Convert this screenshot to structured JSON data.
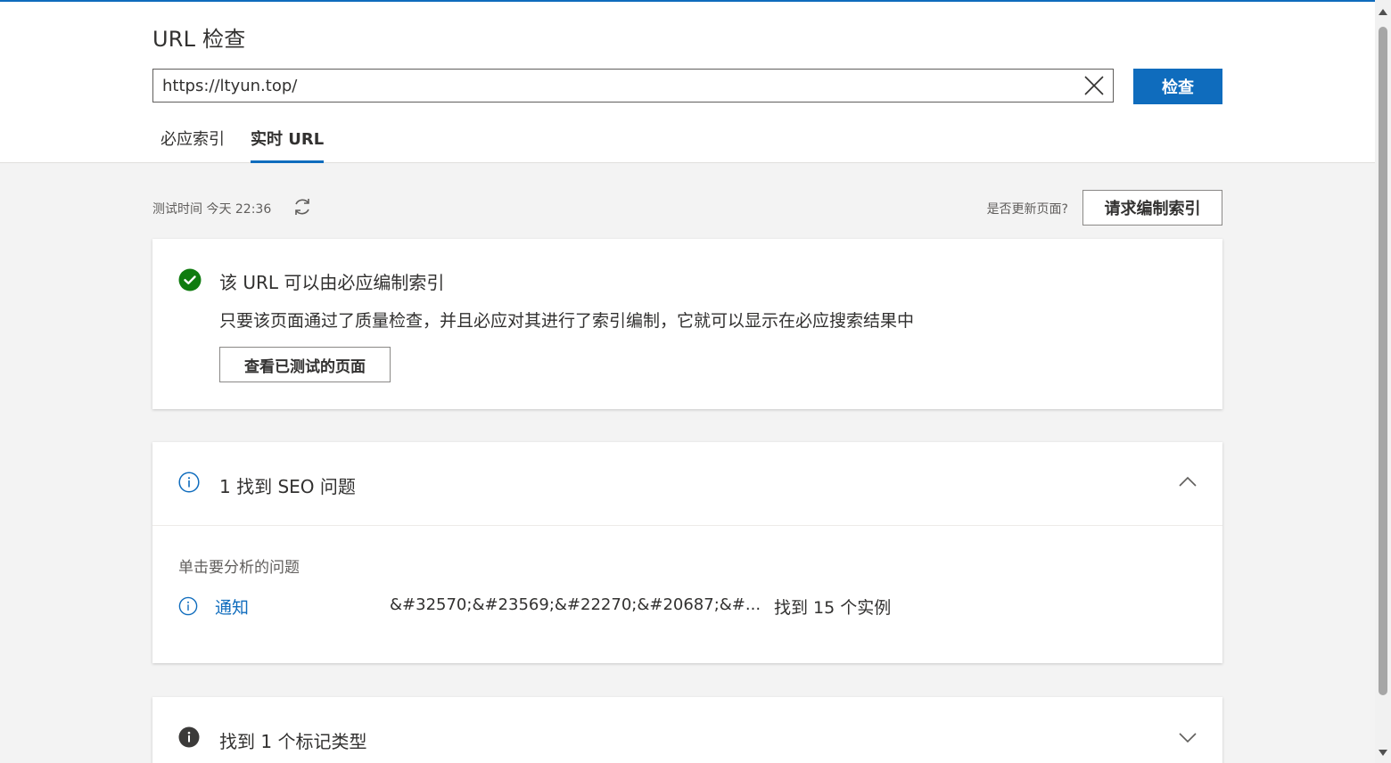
{
  "header": {
    "title": "URL 检查",
    "url_value": "https://ltyun.top/",
    "check_label": "检查",
    "tabs": [
      {
        "label": "必应索引",
        "active": false
      },
      {
        "label": "实时 URL",
        "active": true
      }
    ]
  },
  "meta": {
    "test_time": "测试时间 今天 22:36",
    "update_question": "是否更新页面?",
    "request_index_label": "请求编制索引"
  },
  "index_status": {
    "title": "该 URL 可以由必应编制索引",
    "description": "只要该页面通过了质量检查，并且必应对其进行了索引编制，它就可以显示在必应搜索结果中",
    "view_tested_label": "查看已测试的页面",
    "icon": "check-circle-icon",
    "color": "#107c10"
  },
  "seo_section": {
    "title": "1 找到 SEO 问题",
    "expanded": true,
    "hint": "单击要分析的问题",
    "issues": [
      {
        "type": "通知",
        "detail": "&#32570;&#23569;&#22270;&#20687;&#...",
        "count": "找到 15 个实例"
      }
    ]
  },
  "markup_section": {
    "title": "找到 1 个标记类型",
    "expanded": false
  },
  "colors": {
    "accent": "#0f6cbd",
    "success": "#107c10",
    "info_dark": "#3b3a39"
  }
}
